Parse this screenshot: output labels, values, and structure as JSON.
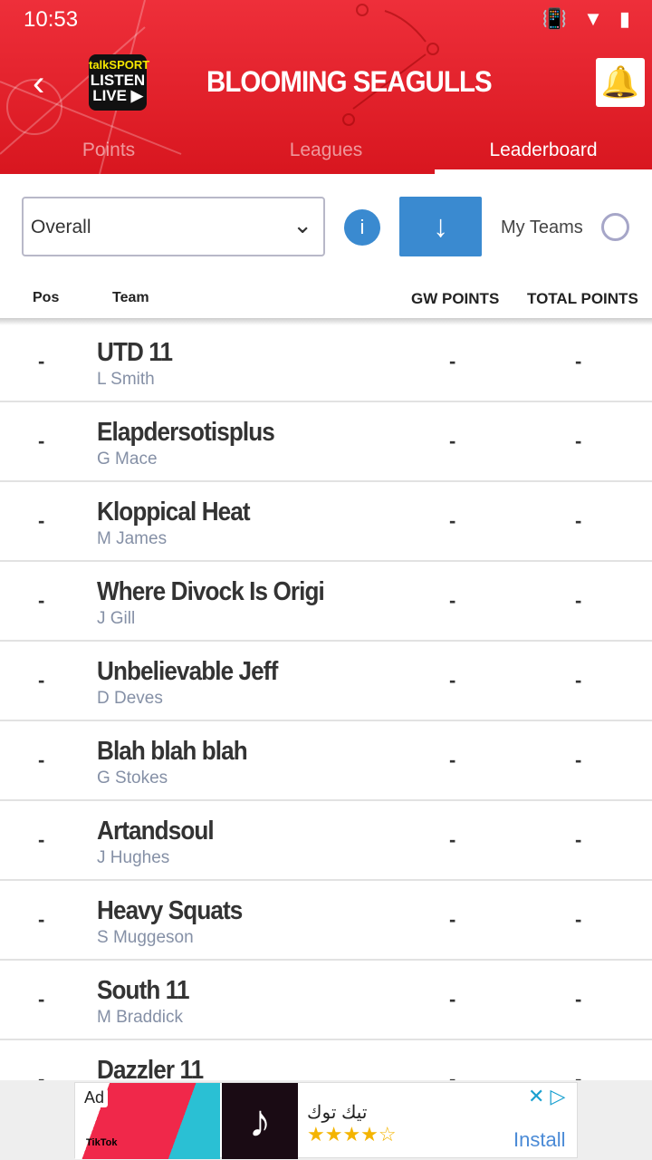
{
  "status_bar": {
    "time": "10:53",
    "icons": [
      "image-icon",
      "cloud-icon",
      "vibrate-icon",
      "wifi-icon",
      "battery-icon"
    ]
  },
  "header": {
    "title": "BLOOMING SEAGULLS",
    "logo": {
      "line1": "talkSPORT",
      "line2": "LISTEN",
      "line3": "LIVE ▶"
    },
    "back": "‹",
    "bell": "🔔"
  },
  "tabs": [
    {
      "label": "Points"
    },
    {
      "label": "Leagues"
    },
    {
      "label": "Leaderboard",
      "active": true
    }
  ],
  "filter": {
    "selected": "Overall",
    "info": "i",
    "download": "↓",
    "my_teams_label": "My Teams",
    "my_teams_checked": false
  },
  "columns": {
    "pos": "Pos",
    "team": "Team",
    "gw": "GW POINTS",
    "total": "TOTAL POINTS"
  },
  "rows": [
    {
      "pos": "-",
      "name": "UTD 11",
      "owner": "L Smith",
      "gw": "-",
      "total": "-"
    },
    {
      "pos": "-",
      "name": "Elapdersotisplus",
      "owner": "G Mace",
      "gw": "-",
      "total": "-"
    },
    {
      "pos": "-",
      "name": "Kloppical Heat",
      "owner": "M James",
      "gw": "-",
      "total": "-"
    },
    {
      "pos": "-",
      "name": "Where Divock Is Origi",
      "owner": "J Gill",
      "gw": "-",
      "total": "-"
    },
    {
      "pos": "-",
      "name": "Unbelievable Jeff",
      "owner": "D Deves",
      "gw": "-",
      "total": "-"
    },
    {
      "pos": "-",
      "name": "Blah blah blah",
      "owner": "G Stokes",
      "gw": "-",
      "total": "-"
    },
    {
      "pos": "-",
      "name": "Artandsoul",
      "owner": "J Hughes",
      "gw": "-",
      "total": "-"
    },
    {
      "pos": "-",
      "name": "Heavy Squats",
      "owner": "S Muggeson",
      "gw": "-",
      "total": "-"
    },
    {
      "pos": "-",
      "name": "South 11",
      "owner": "M Braddick",
      "gw": "-",
      "total": "-"
    },
    {
      "pos": "-",
      "name": "Dazzler 11",
      "owner": "",
      "gw": "-",
      "total": "-"
    }
  ],
  "ad": {
    "label": "Ad",
    "brand": "TikTok",
    "app_name": "تيك توك",
    "rating": 4.5,
    "stars": "★★★★☆",
    "install": "Install",
    "close": "✕ ▷"
  },
  "colors": {
    "header_red": "#e4222c",
    "accent_blue": "#3a8ad0"
  }
}
